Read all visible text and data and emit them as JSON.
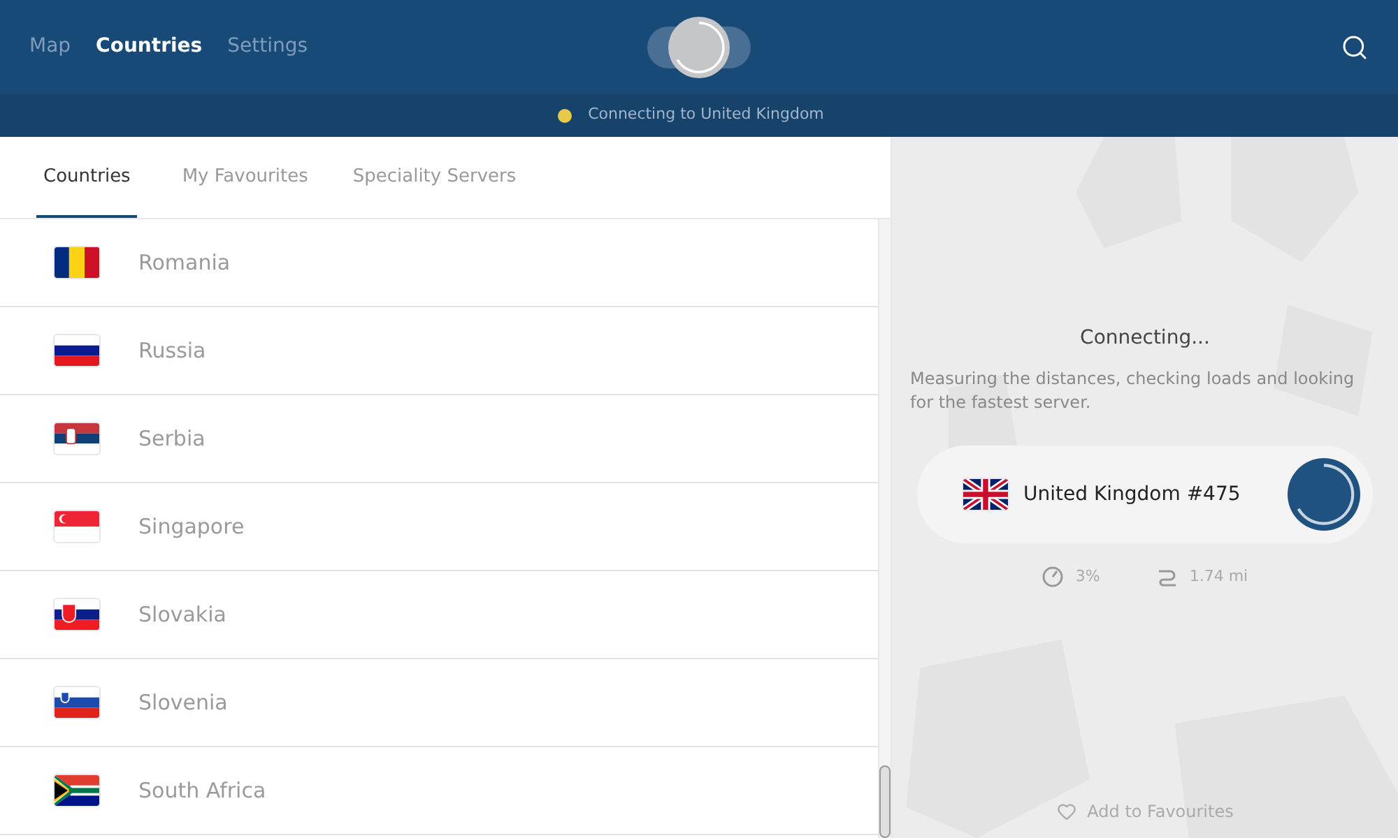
{
  "nav": [
    {
      "label": "Map",
      "selected": false
    },
    {
      "label": "Countries",
      "selected": true
    },
    {
      "label": "Settings",
      "selected": false
    }
  ],
  "status": {
    "text": "Connecting to United Kingdom",
    "color": "#e8c94a"
  },
  "tabs": [
    {
      "label": "Countries",
      "selected": true
    },
    {
      "label": "My Favourites",
      "selected": false
    },
    {
      "label": "Speciality Servers",
      "selected": false
    }
  ],
  "countries": [
    {
      "name": "Romania",
      "kind": "romania"
    },
    {
      "name": "Russia",
      "kind": "russia"
    },
    {
      "name": "Serbia",
      "kind": "serbia"
    },
    {
      "name": "Singapore",
      "kind": "singapore"
    },
    {
      "name": "Slovakia",
      "kind": "slovakia"
    },
    {
      "name": "Slovenia",
      "kind": "slovenia"
    },
    {
      "name": "South Africa",
      "kind": "southafrica"
    }
  ],
  "panel": {
    "title": "Connecting...",
    "message": "Measuring the distances, checking loads and looking for the fastest server.",
    "server": {
      "name": "United Kingdom #475",
      "kind": "uk"
    },
    "load": "3%",
    "distance": "1.74 mi",
    "favourite": "Add to Favourites"
  }
}
